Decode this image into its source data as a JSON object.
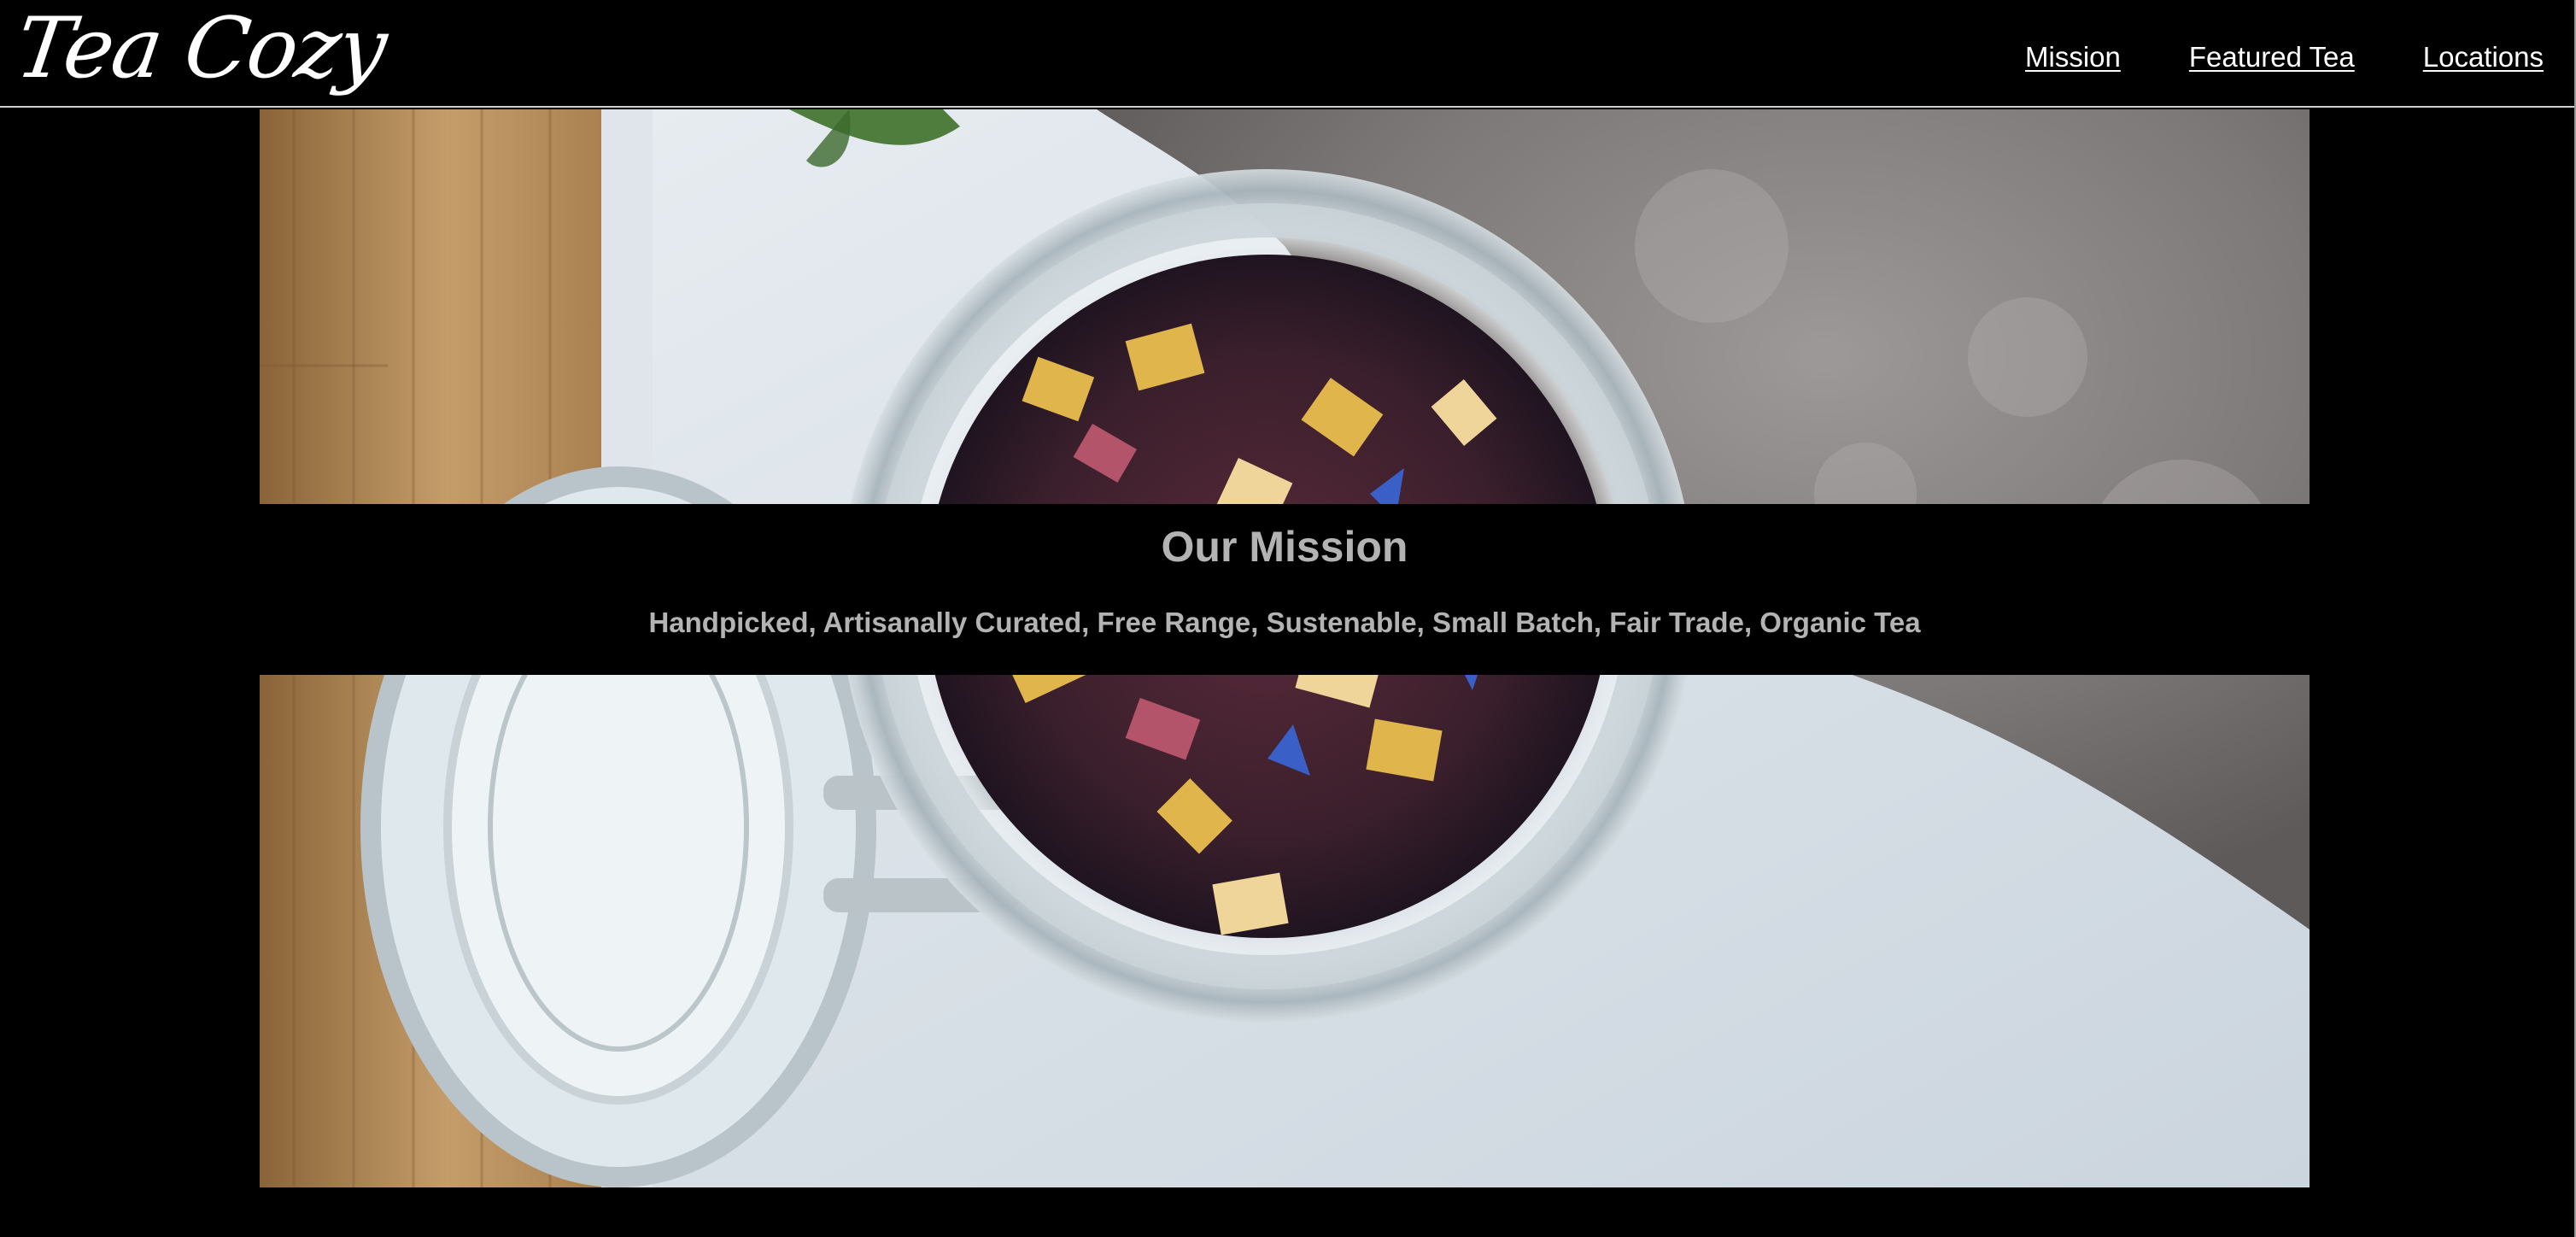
{
  "header": {
    "logo": "Tea Cozy",
    "nav": [
      {
        "label": "Mission"
      },
      {
        "label": "Featured Tea"
      },
      {
        "label": "Locations"
      }
    ]
  },
  "mission": {
    "title": "Our Mission",
    "description": "Handpicked, Artisanally Curated, Free Range, Sustenable, Small Batch, Fair Trade, Organic Tea"
  },
  "colors": {
    "background": "#000000",
    "nav_text": "#ffffff",
    "mission_text": "#b3b3b3"
  },
  "icons": {
    "hero_image": "tea-jar-image"
  }
}
